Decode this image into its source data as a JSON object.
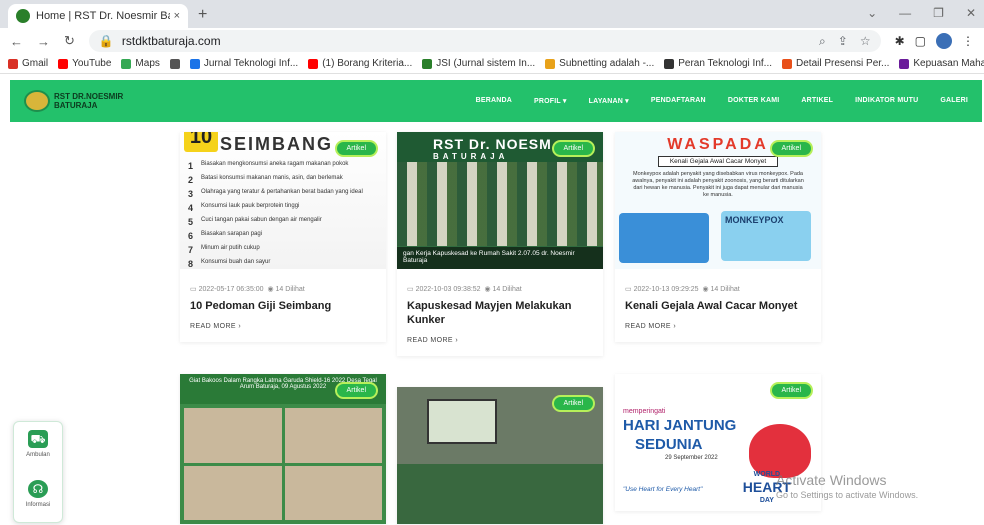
{
  "browser": {
    "tab_title": "Home | RST Dr. Noesmir Baturaja",
    "tab_close": "×",
    "new_tab": "+",
    "url": "rstdktbaturaja.com",
    "bookmarks": [
      {
        "label": "Gmail",
        "color": "#d93025"
      },
      {
        "label": "YouTube",
        "color": "#ff0000"
      },
      {
        "label": "Maps",
        "color": "#34a853"
      },
      {
        "label": "",
        "color": "#555555"
      },
      {
        "label": "Jurnal Teknologi Inf...",
        "color": "#1a73e8"
      },
      {
        "label": "(1) Borang Kriteria...",
        "color": "#ff0000"
      },
      {
        "label": "JSI (Jurnal sistem In...",
        "color": "#2a7f2a"
      },
      {
        "label": "Subnetting adalah -...",
        "color": "#e8a21a"
      },
      {
        "label": "Peran Teknologi Inf...",
        "color": "#333333"
      },
      {
        "label": "Detail Presensi Per...",
        "color": "#e8501a"
      },
      {
        "label": "Kepuasan Mahasis...",
        "color": "#6a1b9a"
      }
    ],
    "more_bookmarks": "»"
  },
  "site": {
    "logo_line1": "RST DR.NOESMIR",
    "logo_line2": "BATURAJA",
    "nav": [
      "BERANDA",
      "PROFIL ▾",
      "LAYANAN ▾",
      "PENDAFTARAN",
      "DOKTER KAMI",
      "ARTIKEL",
      "INDIKATOR MUTU",
      "GALERI"
    ]
  },
  "cards": [
    {
      "tag": "Artikel",
      "date": "2022-05-17 06:35:00",
      "views": "14 Dilihat",
      "title": "10 Pedoman Giji Seimbang",
      "more": "READ MORE ›"
    },
    {
      "tag": "Artikel",
      "date": "2022-10-03 09:38:52",
      "views": "14 Dilihat",
      "title": "Kapuskesad Mayjen Melakukan Kunker",
      "more": "READ MORE ›"
    },
    {
      "tag": "Artikel",
      "date": "2022-10-13 09:29:25",
      "views": "14 Dilihat",
      "title": "Kenali Gejala Awal Cacar Monyet",
      "more": "READ MORE ›"
    },
    {
      "tag": "Artikel"
    },
    {
      "tag": "Artikel"
    },
    {
      "tag": "Artikel"
    }
  ],
  "thumbs": {
    "t1_head": "SEIMBANG",
    "t1_ten": "10",
    "t1_items": [
      {
        "n": "1",
        "text": "Biasakan mengkonsumsi aneka ragam makanan pokok"
      },
      {
        "n": "2",
        "text": "Batasi konsumsi makanan manis, asin, dan berlemak"
      },
      {
        "n": "3",
        "text": "Olahraga yang teratur & pertahankan berat badan yang ideal"
      },
      {
        "n": "4",
        "text": "Konsumsi lauk pauk berprotein tinggi"
      },
      {
        "n": "5",
        "text": "Cuci tangan pakai sabun dengan air mengalir"
      },
      {
        "n": "6",
        "text": "Biasakan sarapan pagi"
      },
      {
        "n": "7",
        "text": "Minum air putih cukup"
      },
      {
        "n": "8",
        "text": "Konsumsi buah dan sayur"
      }
    ],
    "t2_hdr": "RST Dr. NOESM",
    "t2_sub": "BATURAJA",
    "t2_cap": "gan Kerja Kapuskesad ke Rumah Sakit 2.07.05 dr. Noesmir Baturaja",
    "t3_head": "WASPADA",
    "t3_sub": "Kenali Gejala Awal Cacar Monyet",
    "t3_body": "Monkeypox adalah penyakit yang disebabkan virus monkeypox. Pada awalnya, penyakit ini adalah penyakit zoonosis, yang berarti ditularkan dari hewan ke manusia. Penyakit ini juga dapat menular dari manusia ke manusia.",
    "t3_mp": "MONKEYPOX",
    "t4_banner": "Giat Bakoos Dalam Rangka Latma Garuda Shield-16 2022 Desa Tegal Arum Baturaja, 09 Agustus 2022",
    "t6_peringati": "memperingati",
    "t6_big1": "HARI JANTUNG",
    "t6_big2": "SEDUNIA",
    "t6_date": "29 September 2022",
    "t6_quote": "\"Use Heart for Every Heart\"",
    "t6_world": "WORLD",
    "t6_heart": "HEART",
    "t6_day": "DAY"
  },
  "floating": [
    {
      "label": "Ambulan",
      "icon": "ambulance-icon"
    },
    {
      "label": "Informasi",
      "icon": "headset-icon"
    }
  ],
  "watermark": {
    "line1": "Activate Windows",
    "line2": "Go to Settings to activate Windows."
  }
}
